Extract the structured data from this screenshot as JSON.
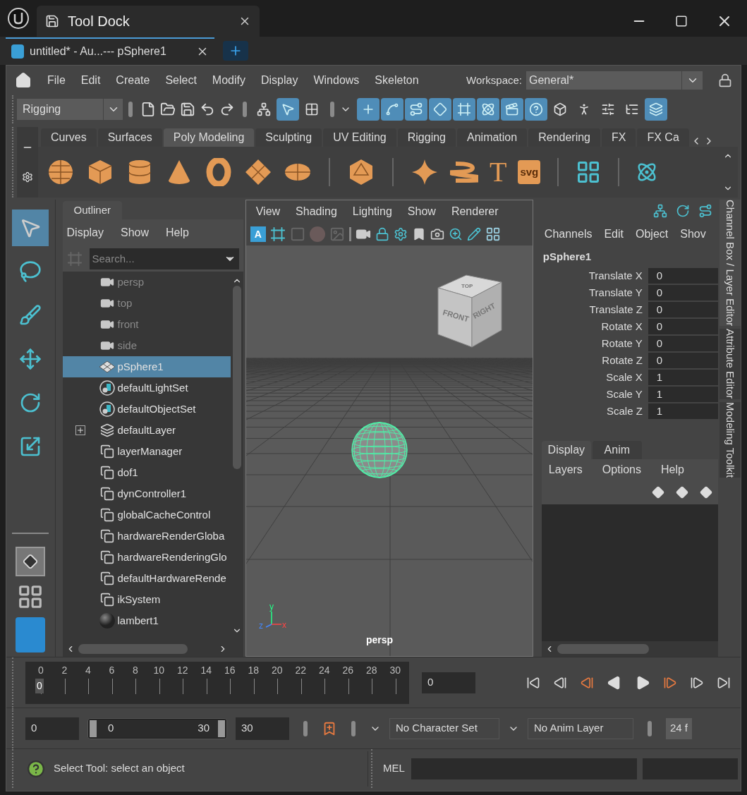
{
  "window": {
    "title": "Tool Dock"
  },
  "document_tab": {
    "title": "untitled* - Au...--- pSphere1"
  },
  "menu": [
    "File",
    "Edit",
    "Create",
    "Select",
    "Modify",
    "Display",
    "Windows",
    "Skeleton"
  ],
  "workspace": {
    "label": "Workspace:",
    "value": "General*"
  },
  "status_line": {
    "menu_set": "Rigging",
    "toggles": [
      {
        "on": false
      },
      {
        "on": true
      },
      {
        "on": false
      },
      {
        "on": true
      },
      {
        "on": true
      },
      {
        "on": true
      },
      {
        "on": true
      },
      {
        "on": true
      },
      {
        "on": true
      },
      {
        "on": true
      },
      {
        "on": true
      },
      {
        "on": false
      },
      {
        "on": false
      },
      {
        "on": false
      },
      {
        "on": false
      },
      {
        "on": true
      }
    ]
  },
  "shelf": {
    "tabs": [
      {
        "label": "Curves",
        "selected": false
      },
      {
        "label": "Surfaces",
        "selected": false
      },
      {
        "label": "Poly Modeling",
        "selected": true
      },
      {
        "label": "Sculpting",
        "selected": false
      },
      {
        "label": "UV Editing",
        "selected": false
      },
      {
        "label": "Rigging",
        "selected": false
      },
      {
        "label": "Animation",
        "selected": false
      },
      {
        "label": "Rendering",
        "selected": false
      },
      {
        "label": "FX",
        "selected": false
      },
      {
        "label": "FX Ca",
        "selected": false
      }
    ],
    "type_tool_label": "T",
    "svg_tool_label": "svg"
  },
  "toolbox": {
    "tools": [
      {
        "selected": true
      },
      {
        "selected": false
      },
      {
        "selected": false
      },
      {
        "selected": false
      },
      {
        "selected": false
      },
      {
        "selected": false
      }
    ]
  },
  "outliner": {
    "tab": "Outliner",
    "menu": [
      "Display",
      "Show",
      "Help"
    ],
    "search": {
      "placeholder": "Search..."
    },
    "rows": [
      {
        "label": "persp",
        "kind": "camera",
        "hidden": true,
        "selected": false,
        "has_children": false
      },
      {
        "label": "top",
        "kind": "camera",
        "hidden": true,
        "selected": false,
        "has_children": false
      },
      {
        "label": "front",
        "kind": "camera",
        "hidden": true,
        "selected": false,
        "has_children": false
      },
      {
        "label": "side",
        "kind": "camera",
        "hidden": true,
        "selected": false,
        "has_children": false
      },
      {
        "label": "pSphere1",
        "kind": "mesh",
        "hidden": false,
        "selected": true,
        "has_children": false
      },
      {
        "label": "defaultLightSet",
        "kind": "set",
        "hidden": false,
        "selected": false,
        "has_children": false
      },
      {
        "label": "defaultObjectSet",
        "kind": "set",
        "hidden": false,
        "selected": false,
        "has_children": false
      },
      {
        "label": "defaultLayer",
        "kind": "layer",
        "hidden": false,
        "selected": false,
        "has_children": true
      },
      {
        "label": "layerManager",
        "kind": "node",
        "hidden": false,
        "selected": false,
        "has_children": false
      },
      {
        "label": "dof1",
        "kind": "node",
        "hidden": false,
        "selected": false,
        "has_children": false
      },
      {
        "label": "dynController1",
        "kind": "node",
        "hidden": false,
        "selected": false,
        "has_children": false
      },
      {
        "label": "globalCacheControl",
        "kind": "node",
        "hidden": false,
        "selected": false,
        "has_children": false
      },
      {
        "label": "hardwareRenderGloba",
        "kind": "node",
        "hidden": false,
        "selected": false,
        "has_children": false
      },
      {
        "label": "hardwareRenderingGlo",
        "kind": "node",
        "hidden": false,
        "selected": false,
        "has_children": false
      },
      {
        "label": "defaultHardwareRende",
        "kind": "node",
        "hidden": false,
        "selected": false,
        "has_children": false
      },
      {
        "label": "ikSystem",
        "kind": "node",
        "hidden": false,
        "selected": false,
        "has_children": false
      },
      {
        "label": "lambert1",
        "kind": "shader",
        "hidden": false,
        "selected": false,
        "has_children": false
      }
    ]
  },
  "viewport": {
    "menu": [
      "View",
      "Shading",
      "Lighting",
      "Show",
      "Renderer"
    ],
    "render_badge": "A",
    "view_cube": {
      "top": "TOP",
      "front": "FRONT",
      "right": "RIGHT"
    },
    "axes": {
      "x": "x",
      "y": "y",
      "z": "z"
    },
    "camera": "persp"
  },
  "channel_box": {
    "menu": [
      "Channels",
      "Edit",
      "Object",
      "Shov"
    ],
    "object": "pSphere1",
    "channels": [
      {
        "label": "Translate X",
        "value": "0"
      },
      {
        "label": "Translate Y",
        "value": "0"
      },
      {
        "label": "Translate Z",
        "value": "0"
      },
      {
        "label": "Rotate X",
        "value": "0"
      },
      {
        "label": "Rotate Y",
        "value": "0"
      },
      {
        "label": "Rotate Z",
        "value": "0"
      },
      {
        "label": "Scale X",
        "value": "1"
      },
      {
        "label": "Scale Y",
        "value": "1"
      },
      {
        "label": "Scale Z",
        "value": "1"
      }
    ]
  },
  "layer_editor": {
    "tabs": [
      {
        "label": "Display",
        "selected": true
      },
      {
        "label": "Anim",
        "selected": false
      }
    ],
    "menu": [
      "Layers",
      "Options",
      "Help"
    ]
  },
  "side_tabs": [
    {
      "label": "Channel Box / Layer Editor",
      "selected": true
    },
    {
      "label": "Attribute Editor",
      "selected": false
    },
    {
      "label": "Modeling Toolkit",
      "selected": false
    }
  ],
  "time_slider": {
    "ticks": [
      "0",
      "2",
      "4",
      "6",
      "8",
      "10",
      "12",
      "14",
      "16",
      "18",
      "20",
      "22",
      "24",
      "26",
      "28",
      "30"
    ],
    "current_frame_marker": "0",
    "current_frame": "0"
  },
  "range_slider": {
    "level": 1,
    "start": "0",
    "range_start": "0",
    "range_end": "30",
    "end": "30",
    "character_set": "No Character Set",
    "anim_layer": "No Anim Layer",
    "fps": "24 f"
  },
  "help_line": {
    "message": "Select Tool: select an object"
  },
  "command_line": {
    "language": "MEL"
  }
}
